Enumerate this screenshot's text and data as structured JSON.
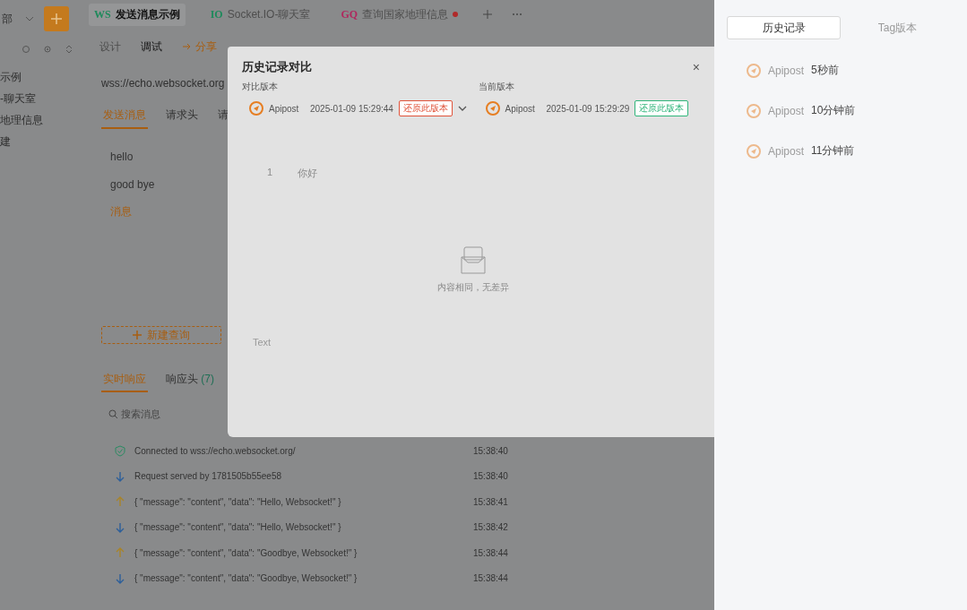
{
  "sidebar": {
    "workspace": "部",
    "items": [
      {
        "label": "示例"
      },
      {
        "label": "-聊天室"
      },
      {
        "label": "地理信息"
      },
      {
        "label": "建"
      }
    ]
  },
  "tabs": [
    {
      "badge": "WS",
      "color": "#1f8a5c",
      "label": "发送消息示例",
      "selected": true,
      "modified": false
    },
    {
      "badge": "IO",
      "color": "#1f8a5c",
      "label": "Socket.IO-聊天室",
      "selected": false,
      "modified": false
    },
    {
      "badge": "GQ",
      "color": "#b0285e",
      "label": "查询国家地理信息",
      "selected": false,
      "modified": true
    }
  ],
  "mode_tabs": [
    {
      "label": "设计",
      "selected": false
    },
    {
      "label": "调试",
      "selected": true
    }
  ],
  "share_button": "分享",
  "url": "wss://echo.websocket.org",
  "request_tabs": [
    {
      "label": "发送消息",
      "selected": true
    },
    {
      "label": "请求头",
      "selected": false
    },
    {
      "label": "请",
      "selected": false
    }
  ],
  "messages": [
    {
      "label": "hello",
      "selected": false
    },
    {
      "label": "good bye",
      "selected": false
    },
    {
      "label": "消息",
      "selected": true
    }
  ],
  "new_query_button": "新建查询",
  "response_tabs": [
    {
      "label": "实时响应",
      "selected": true
    },
    {
      "label": "响应头",
      "count": "(7)",
      "selected": false
    }
  ],
  "search": {
    "placeholder": "搜索消息"
  },
  "log": [
    {
      "kind": "connected",
      "text": "Connected to wss://echo.websocket.org/",
      "time": "15:38:40"
    },
    {
      "kind": "received",
      "text": "Request served by 1781505b55ee58",
      "time": "15:38:40"
    },
    {
      "kind": "sent",
      "text": "{ \"message\": \"content\", \"data\": \"Hello, Websocket!\" }",
      "time": "15:38:41"
    },
    {
      "kind": "received",
      "text": "{ \"message\": \"content\", \"data\": \"Hello, Websocket!\" }",
      "time": "15:38:42"
    },
    {
      "kind": "sent",
      "text": "{ \"message\": \"content\", \"data\": \"Goodbye, Websocket!\" }",
      "time": "15:38:44"
    },
    {
      "kind": "received",
      "text": "{ \"message\": \"content\", \"data\": \"Goodbye, Websocket!\" }",
      "time": "15:38:44"
    }
  ],
  "modal": {
    "title": "历史记录对比",
    "close": "×",
    "versions": [
      {
        "label": "对比版本",
        "author": "Apipost",
        "time": "2025-01-09 15:29:44",
        "restore": "还原此版本",
        "color": "#e0533a",
        "dropdown": true
      },
      {
        "label": "当前版本",
        "author": "Apipost",
        "time": "2025-01-09 15:29:29",
        "restore": "还原此版本",
        "color": "#2fb57a",
        "dropdown": false
      }
    ],
    "diff_lines": [
      {
        "number": "1",
        "text": "你好"
      }
    ],
    "empty_state": "内容相同，无差异",
    "format": "Text"
  },
  "history_panel": {
    "tabs": [
      {
        "label": "历史记录",
        "selected": true
      },
      {
        "label": "Tag版本",
        "selected": false
      }
    ],
    "items": [
      {
        "author": "Apipost",
        "time": "5秒前"
      },
      {
        "author": "Apipost",
        "time": "10分钟前"
      },
      {
        "author": "Apipost",
        "time": "11分钟前"
      }
    ]
  }
}
